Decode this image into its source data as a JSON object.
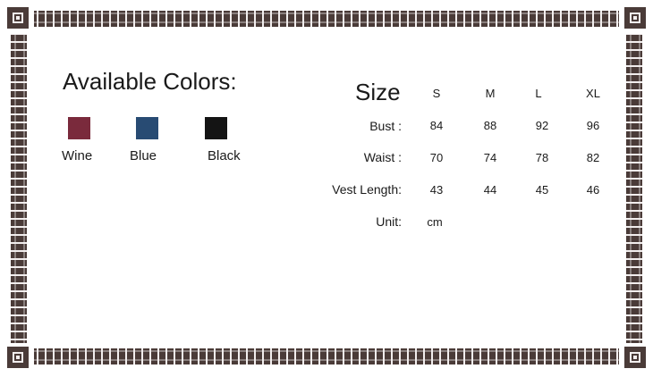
{
  "colors": {
    "title": "Available Colors:",
    "items": [
      {
        "label": "Wine",
        "hex": "#7a2a3c"
      },
      {
        "label": "Blue",
        "hex": "#284b73"
      },
      {
        "label": "Black",
        "hex": "#141414"
      }
    ]
  },
  "size_chart": {
    "title": "Size",
    "sizes": [
      "S",
      "M",
      "L",
      "XL"
    ],
    "rows": [
      {
        "label": "Bust :",
        "values": [
          "84",
          "88",
          "92",
          "96"
        ]
      },
      {
        "label": "Waist :",
        "values": [
          "70",
          "74",
          "78",
          "82"
        ]
      },
      {
        "label": "Vest Length:",
        "values": [
          "43",
          "44",
          "45",
          "46"
        ]
      },
      {
        "label": "Unit:",
        "values": [
          "cm"
        ]
      }
    ]
  },
  "frame_color": "#4a3b38"
}
